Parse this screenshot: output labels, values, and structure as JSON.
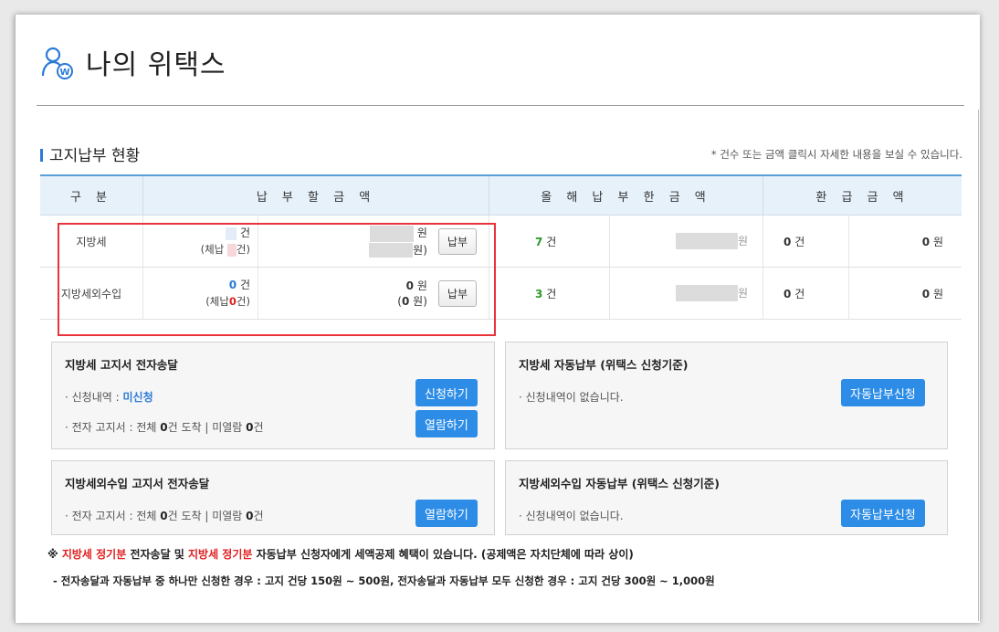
{
  "header": {
    "title": "나의 위택스"
  },
  "section": {
    "title": "고지납부 현황",
    "note": "* 건수 또는 금액 클릭시 자세한 내용을 보실 수 있습니다."
  },
  "table": {
    "headers": [
      "구 분",
      "납 부 할  금 액",
      "올 해  납 부 한  금 액",
      "환 급 금 액"
    ],
    "rows": [
      {
        "category": "지방세",
        "due_count_unit": "건",
        "due_arrears_label": "(체납",
        "due_arrears_unit": "건)",
        "due_amount_unit": "원",
        "due_arrears_amount_unit": "원)",
        "pay_button": "납부",
        "paid_count": "7",
        "paid_count_unit": "건",
        "paid_amount_tail": "원",
        "refund_count": "0",
        "refund_count_unit": "건",
        "refund_amount": "0",
        "refund_amount_unit": "원"
      },
      {
        "category": "지방세외수입",
        "due_count": "0",
        "due_count_unit": "건",
        "due_arrears_label": "(체납",
        "due_arrears_count": "0",
        "due_arrears_unit": "건)",
        "due_amount": "0",
        "due_amount_unit": "원",
        "due_arrears_amount_open": "(",
        "due_arrears_amount": "0",
        "due_arrears_amount_unit": "원)",
        "pay_button": "납부",
        "paid_count": "3",
        "paid_count_unit": "건",
        "paid_amount_tail": "원",
        "refund_count": "0",
        "refund_count_unit": "건",
        "refund_amount": "0",
        "refund_amount_unit": "원"
      }
    ]
  },
  "boxes": {
    "ebill": {
      "title": "지방세 고지서 전자송달",
      "line1_label": "· 신청내역 :",
      "line1_value": "미신청",
      "line2_pre": "· 전자 고지서 : 전체",
      "line2_total": "0",
      "line2_mid": "건 도착  |  미열람",
      "line2_unread": "0",
      "line2_post": "건",
      "apply_button": "신청하기",
      "view_button": "열람하기"
    },
    "autopay": {
      "title": "지방세 자동납부 (위택스 신청기준)",
      "line1": "· 신청내역이 없습니다.",
      "button": "자동납부신청"
    },
    "nontax_ebill": {
      "title": "지방세외수입 고지서 전자송달",
      "line1_pre": "· 전자 고지서 : 전체",
      "line1_total": "0",
      "line1_mid": "건 도착  |  미열람",
      "line1_unread": "0",
      "line1_post": "건",
      "view_button": "열람하기"
    },
    "nontax_autopay": {
      "title": "지방세외수입 자동납부 (위택스 신청기준)",
      "line1": "· 신청내역이 없습니다.",
      "button": "자동납부신청"
    }
  },
  "notice": {
    "p1_mark": "※ ",
    "p1_red1": "지방세 정기분",
    "p1_mid": " 전자송달 및 ",
    "p1_red2": "지방세 정기분",
    "p1_tail": " 자동납부 신청자에게 세액공제 혜택이 있습니다. (공제액은 자치단체에 따라 상이)",
    "p2": "- 전자송달과 자동납부 중 하나만 신청한 경우 : 고지 건당 150원 ~ 500원, 전자송달과 자동납부 모두 신청한 경우 : 고지 건당 300원 ~ 1,000원"
  },
  "colors": {
    "accent": "#2d8de6",
    "highlight": "#e8333b",
    "warn": "#e02020"
  }
}
